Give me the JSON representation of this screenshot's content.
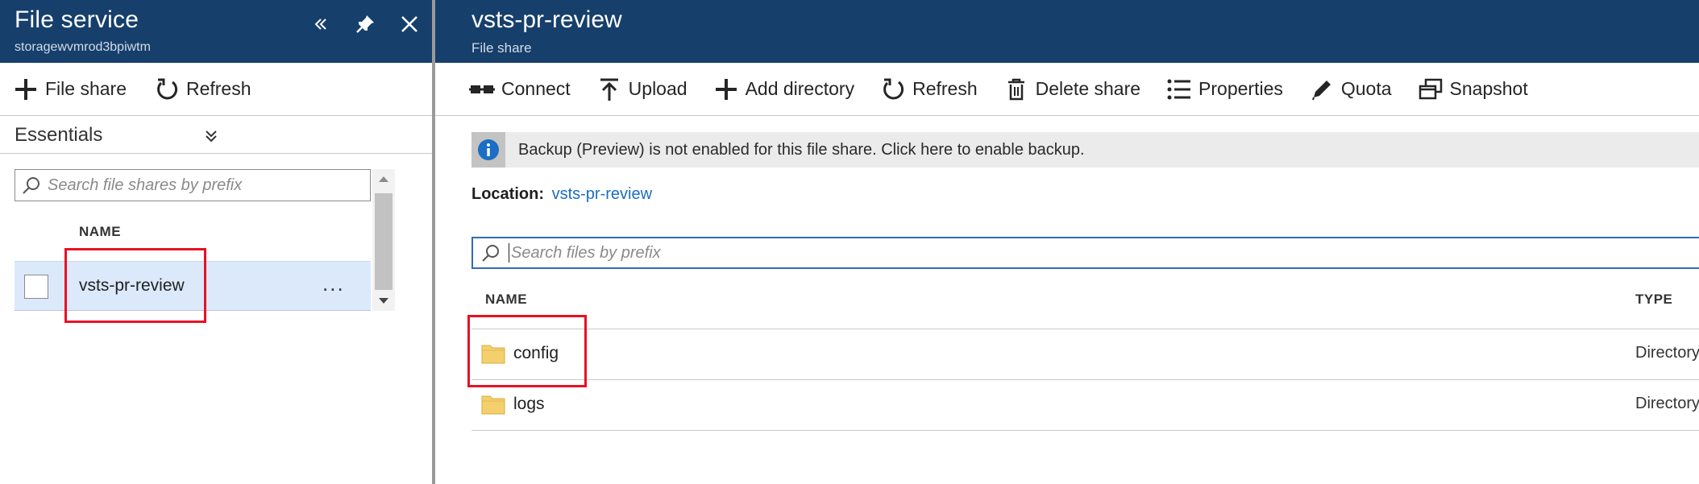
{
  "left_blade": {
    "title": "File service",
    "subtitle": "storagewvmrod3bpiwtm",
    "header_buttons": [
      "collapse",
      "pin",
      "close"
    ],
    "toolbar": {
      "file_share_label": "File share",
      "refresh_label": "Refresh"
    },
    "essentials_label": "Essentials",
    "search_placeholder": "Search file shares by prefix",
    "column_name": "NAME",
    "shares": [
      {
        "name": "vsts-pr-review",
        "selected": true,
        "more_label": "..."
      }
    ]
  },
  "right_blade": {
    "title": "vsts-pr-review",
    "subtitle": "File share",
    "toolbar": {
      "connect_label": "Connect",
      "upload_label": "Upload",
      "add_directory_label": "Add directory",
      "refresh_label": "Refresh",
      "delete_share_label": "Delete share",
      "properties_label": "Properties",
      "quota_label": "Quota",
      "snapshot_label": "Snapshot"
    },
    "info_message": "Backup (Preview) is not enabled for this file share. Click here to enable backup.",
    "location_label": "Location:",
    "location_value": "vsts-pr-review",
    "search_placeholder": "Search files by prefix",
    "columns": {
      "name": "NAME",
      "type": "TYPE"
    },
    "files": [
      {
        "name": "config",
        "type": "Directory"
      },
      {
        "name": "logs",
        "type": "Directory"
      }
    ]
  },
  "colors": {
    "header_bg": "#163f6b",
    "selection_bg": "#dbe9fb",
    "link": "#1a6ec4",
    "highlight": "#e81123",
    "folder": "#f4cf6e"
  }
}
